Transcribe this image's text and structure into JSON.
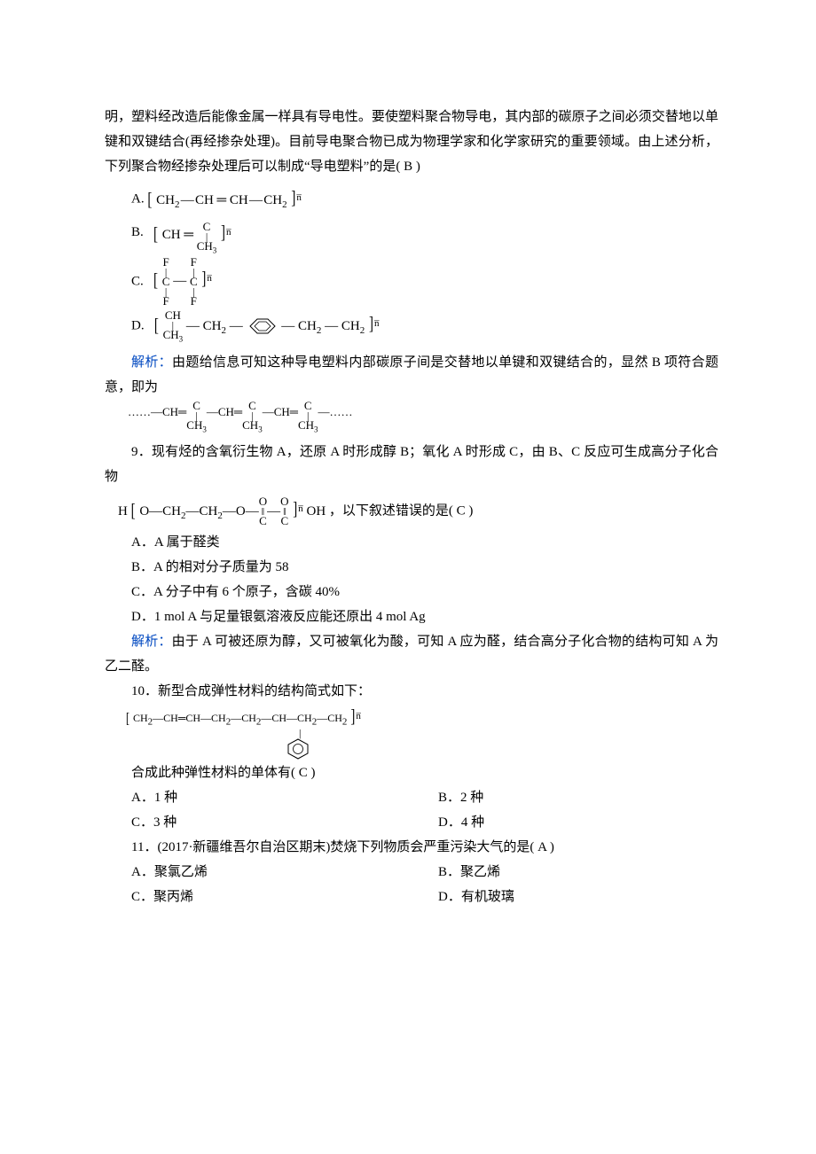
{
  "intro_passage": "明，塑料经改造后能像金属一样具有导电性。要使塑料聚合物导电，其内部的碳原子之间必须交替地以单键和双键结合(再经掺杂处理)。目前导电聚合物已成为物理学家和化学家研究的重要领域。由上述分析，下列聚合物经掺杂处理后可以制成“导电塑料”的是(   B   )",
  "q8": {
    "optA_label": "A.",
    "optB_label": "B.",
    "optC_label": "C.",
    "optD_label": "D.",
    "explain_label": "解析：",
    "explain_text": "由题给信息可知这种导电塑料内部碳原子间是交替地以单键和双键结合的，显然 B 项符合题意，即为"
  },
  "q9": {
    "stem1": "9．现有烃的含氧衍生物 A，还原 A 时形成醇 B；氧化 A 时形成 C，由 B、C 反应可生成高分子化合物",
    "stem2_tail": "，以下叙述错误的是(   C   )",
    "optA": "A．A 属于醛类",
    "optB": "B．A 的相对分子质量为 58",
    "optC": "C．A 分子中有 6 个原子，含碳 40%",
    "optD": "D．1 mol A 与足量银氨溶液反应能还原出 4 mol Ag",
    "explain_label": "解析：",
    "explain_text": "由于 A 可被还原为醇，又可被氧化为酸，可知 A 应为醛，结合高分子化合物的结构可知 A 为乙二醛。"
  },
  "q10": {
    "stem": "10．新型合成弹性材料的结构简式如下：",
    "stem2": "合成此种弹性材料的单体有(   C   )",
    "optA": "A．1 种",
    "optB": "B．2 种",
    "optC": "C．3 种",
    "optD": "D．4 种"
  },
  "q11": {
    "stem": "11．(2017·新疆维吾尔自治区期末)焚烧下列物质会严重污染大气的是(   A   )",
    "optA": "A．聚氯乙烯",
    "optB": "B．聚乙烯",
    "optC": "C．聚丙烯",
    "optD": "D．有机玻璃"
  }
}
